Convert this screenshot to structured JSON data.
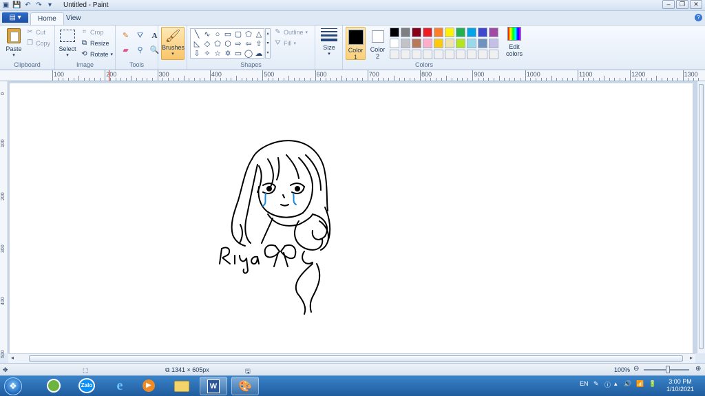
{
  "window": {
    "title": "Untitled - Paint",
    "qat_icons": [
      "paint-app-icon",
      "save-icon",
      "undo-icon",
      "redo-icon",
      "customize-qat-icon"
    ],
    "controls": [
      "minimize",
      "restore",
      "close"
    ]
  },
  "tabs": {
    "file": "▤ ▾",
    "items": [
      "Home",
      "View"
    ],
    "active": "Home"
  },
  "ribbon": {
    "clipboard": {
      "label": "Clipboard",
      "paste": "Paste",
      "cut": "Cut",
      "copy": "Copy"
    },
    "image": {
      "label": "Image",
      "select": "Select",
      "crop": "Crop",
      "resize": "Resize",
      "rotate": "Rotate"
    },
    "tools": {
      "label": "Tools",
      "icons": [
        "pencil-icon",
        "fill-icon",
        "text-icon",
        "eraser-icon",
        "color-picker-icon",
        "magnifier-icon"
      ]
    },
    "brushes": {
      "label": "Brushes"
    },
    "shapes": {
      "label": "Shapes",
      "outline": "Outline",
      "fill": "Fill"
    },
    "size": {
      "label": "Size"
    },
    "colors": {
      "label": "Colors",
      "color1": "Color\n1",
      "color1_line1": "Color",
      "color1_line2": "1",
      "color2_line1": "Color",
      "color2_line2": "2",
      "color1_value": "#000000",
      "color2_value": "#ffffff",
      "edit": "Edit colors",
      "palette_row1": [
        "#000000",
        "#7f7f7f",
        "#880015",
        "#ed1c24",
        "#ff7f27",
        "#fff200",
        "#22b14c",
        "#00a2e8",
        "#3f48cc",
        "#a349a4"
      ],
      "palette_row2": [
        "#ffffff",
        "#c3c3c3",
        "#b97a57",
        "#ffaec9",
        "#ffc90e",
        "#efe4b0",
        "#b5e61d",
        "#99d9ea",
        "#7092be",
        "#c8bfe7"
      ],
      "palette_row3": [
        "#f0f0f0",
        "#f0f0f0",
        "#f0f0f0",
        "#f0f0f0",
        "#f0f0f0",
        "#f0f0f0",
        "#f0f0f0",
        "#f0f0f0",
        "#f0f0f0",
        "#f0f0f0"
      ]
    }
  },
  "ruler": {
    "h_labels": [
      "100",
      "200",
      "300",
      "400",
      "500",
      "600",
      "700",
      "800",
      "900",
      "1000",
      "1100",
      "1200",
      "1300"
    ],
    "v_labels": [
      "0",
      "100",
      "200",
      "300",
      "400",
      "500"
    ]
  },
  "drawing": {
    "signature": "Riya"
  },
  "status": {
    "canvas_size": "1341 × 605px",
    "zoom": "100%"
  },
  "taskbar": {
    "apps": [
      "start-button",
      "app-green-icon",
      "zalo-icon",
      "internet-explorer-icon",
      "media-player-icon",
      "file-explorer-icon",
      "word-icon",
      "paint-icon"
    ],
    "zalo_label": "Zalo",
    "word_label": "W",
    "lang": "EN",
    "time": "3:00 PM",
    "date": "1/10/2021"
  }
}
